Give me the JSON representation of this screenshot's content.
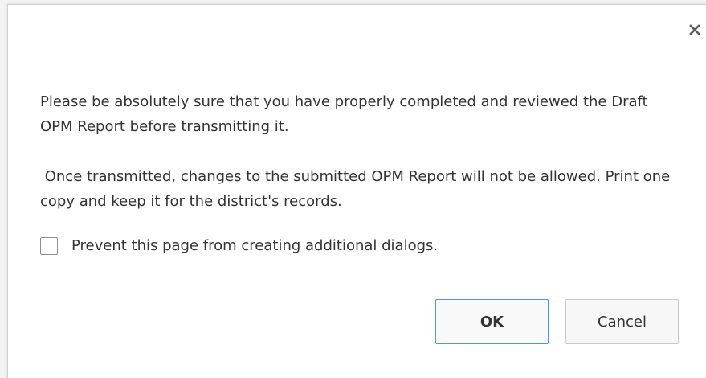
{
  "dialog": {
    "close_icon": "close-icon",
    "messages": [
      "Please be absolutely sure that you have properly completed and reviewed the Draft OPM Report before transmitting it.",
      " Once transmitted, changes to the submitted OPM Report will not be allowed. Print one copy and keep it for the district's records."
    ],
    "suppress_checkbox": {
      "label": "Prevent this page from creating additional dialogs.",
      "checked": false
    },
    "buttons": {
      "ok_label": "OK",
      "cancel_label": "Cancel"
    },
    "colors": {
      "focus_border": "#4d90fe",
      "text": "#333333"
    }
  }
}
